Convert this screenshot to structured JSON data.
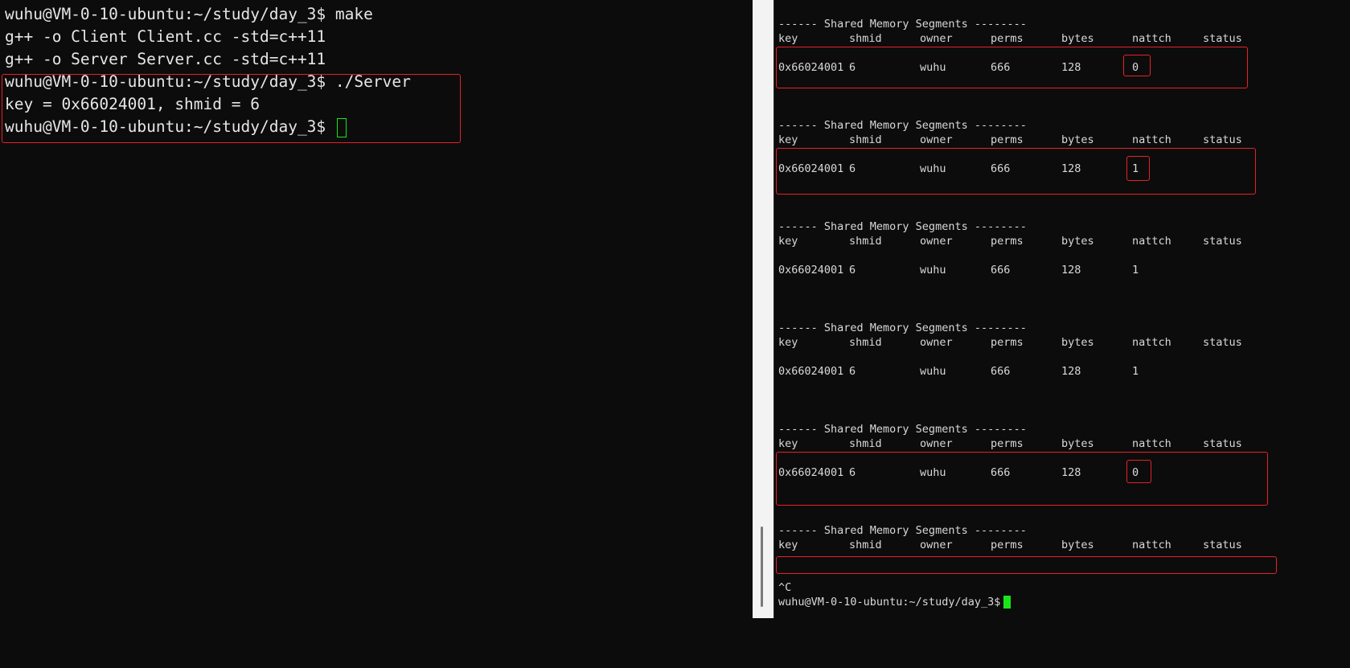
{
  "left_terminal": {
    "lines": [
      "wuhu@VM-0-10-ubuntu:~/study/day_3$ make",
      "g++ -o Client Client.cc -std=c++11",
      "g++ -o Server Server.cc -std=c++11",
      "wuhu@VM-0-10-ubuntu:~/study/day_3$ ./Server",
      "key = 0x66024001, shmid = 6",
      "wuhu@VM-0-10-ubuntu:~/study/day_3$ "
    ],
    "cursor_icon": "outlined-block-cursor"
  },
  "right_terminal": {
    "section_title": "------ Shared Memory Segments --------",
    "columns": [
      "key",
      "shmid",
      "owner",
      "perms",
      "bytes",
      "nattch",
      "status"
    ],
    "sections": [
      {
        "row": [
          "0x66024001",
          "6",
          "wuhu",
          "666",
          "128",
          "0",
          ""
        ]
      },
      {
        "row": [
          "0x66024001",
          "6",
          "wuhu",
          "666",
          "128",
          "1",
          ""
        ]
      },
      {
        "row": [
          "0x66024001",
          "6",
          "wuhu",
          "666",
          "128",
          "1",
          ""
        ]
      },
      {
        "row": [
          "0x66024001",
          "6",
          "wuhu",
          "666",
          "128",
          "1",
          ""
        ]
      },
      {
        "row": [
          "0x66024001",
          "6",
          "wuhu",
          "666",
          "128",
          "0",
          ""
        ]
      },
      {
        "row": null
      }
    ],
    "interrupt": "^C",
    "prompt": "wuhu@VM-0-10-ubuntu:~/study/day_3$",
    "cursor_icon": "filled-block-cursor"
  },
  "colors": {
    "background": "#0c0c0c",
    "text": "#e6e6e6",
    "highlight": "#e8202a",
    "cursor": "#19e619"
  }
}
